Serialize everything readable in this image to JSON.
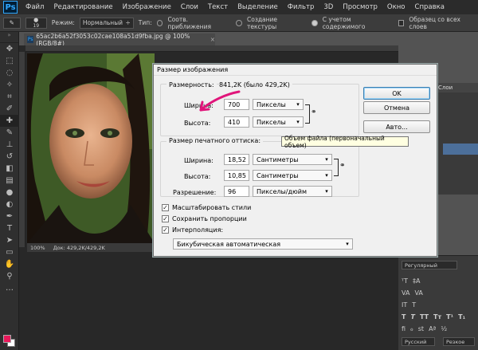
{
  "menubar": {
    "logo": "Ps",
    "items": [
      "Файл",
      "Редактирование",
      "Изображение",
      "Слои",
      "Текст",
      "Выделение",
      "Фильтр",
      "3D",
      "Просмотр",
      "Окно",
      "Справка"
    ]
  },
  "options": {
    "brush_size": "19",
    "mode_label": "Режим:",
    "mode_value": "Нормальный",
    "type_label": "Тип:",
    "type_opt1": "Соотв. приближения",
    "type_opt2": "Создание текстуры",
    "type_opt3": "С учетом содержимого",
    "sample_all": "Образец со всех слоев"
  },
  "document": {
    "tab_title": "65ac2b6a52f3053c02cae108a51d9fba.jpg @ 100% (RGB/8#)",
    "zoom": "100%",
    "doc_size": "Док: 429,2K/429,2K"
  },
  "panels": {
    "tab_right": "Слои",
    "char_font": "Регулярный",
    "char_lang": "Русский",
    "char_aa": "Резкое"
  },
  "dialog": {
    "title": "Размер изображения",
    "dimensions_label": "Размерность:",
    "dimensions_value": "841,2K (было 429,2K)",
    "width_label": "Ширина:",
    "width_value": "700",
    "width_unit": "Пикселы",
    "height_label": "Высота:",
    "height_value": "410",
    "height_unit": "Пикселы",
    "print_group": "Размер печатного оттиска:",
    "print_width_label": "Ширина:",
    "print_width_value": "18,52",
    "print_width_unit": "Сантиметры",
    "print_height_label": "Высота:",
    "print_height_value": "10,85",
    "print_height_unit": "Сантиметры",
    "resolution_label": "Разрешение:",
    "resolution_value": "96",
    "resolution_unit": "Пикселы/дюйм",
    "chk_scale": "Масштабировать стили",
    "chk_constrain": "Сохранить пропорции",
    "chk_resample": "Интерполяция:",
    "interp_method": "Бикубическая автоматическая",
    "ok": "OK",
    "cancel": "Отмена",
    "auto": "Авто...",
    "tooltip": "Объем файла (первоначальный объем)"
  },
  "colors": {
    "foreground": "#e8185a",
    "annotation": "#e0157a"
  }
}
